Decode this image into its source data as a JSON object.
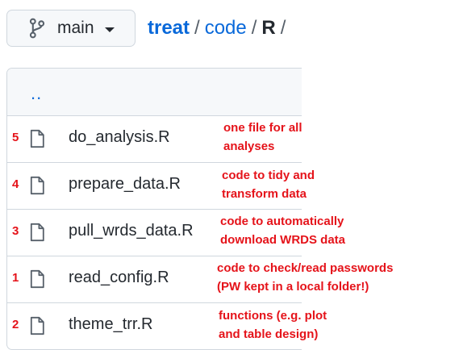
{
  "branch": {
    "label": "main",
    "icon": "git-branch-icon"
  },
  "breadcrumb": {
    "root": "treat",
    "sep1": "/",
    "folder": "code",
    "sep2": "/",
    "current": "R",
    "trailing_sep": "/"
  },
  "file_list": {
    "parent_link": "..",
    "rows": [
      {
        "rank": "5",
        "name": "do_analysis.R",
        "icon": "file-icon"
      },
      {
        "rank": "4",
        "name": "prepare_data.R",
        "icon": "file-icon"
      },
      {
        "rank": "3",
        "name": "pull_wrds_data.R",
        "icon": "file-icon"
      },
      {
        "rank": "1",
        "name": "read_config.R",
        "icon": "file-icon"
      },
      {
        "rank": "2",
        "name": "theme_trr.R",
        "icon": "file-icon"
      }
    ]
  },
  "annotations": [
    {
      "line1": "one file for all",
      "line2": "analyses"
    },
    {
      "line1": "code to tidy and",
      "line2": "transform data"
    },
    {
      "line1": "code to automatically",
      "line2": "download WRDS data"
    },
    {
      "line1": "code to check/read passwords",
      "line2": "(PW kept in a local folder!)"
    },
    {
      "line1": "functions (e.g. plot",
      "line2": "and table design)"
    }
  ],
  "colors": {
    "link": "#0969da",
    "annotation": "#e5131a",
    "text": "#24292f",
    "border": "#d0d7de"
  }
}
